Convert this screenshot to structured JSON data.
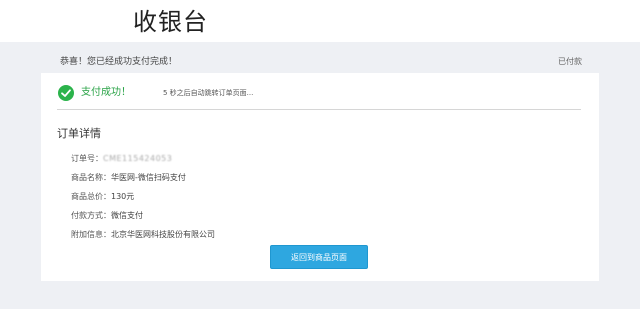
{
  "header": {
    "title": "收银台"
  },
  "notice": {
    "message": "恭喜！您已经成功支付完成！",
    "paid_status": "已付款"
  },
  "success": {
    "label": "支付成功！",
    "redirect_message": "5 秒之后自动跳转订单页面..."
  },
  "details": {
    "title": "订单详情",
    "rows": [
      {
        "label": "订单号：",
        "value": "CME115424053"
      },
      {
        "label": "商品名称：",
        "value": "华医网-微信扫码支付"
      },
      {
        "label": "商品总价：",
        "value": "130元"
      },
      {
        "label": "付款方式：",
        "value": "微信支付"
      },
      {
        "label": "附加信息：",
        "value": "北京华医网科技股份有限公司"
      }
    ]
  },
  "actions": {
    "return_label": "返回到商品页面"
  },
  "colors": {
    "success_green": "#2bb34b",
    "button_blue": "#2ea7e0",
    "background": "#eef0f4"
  }
}
